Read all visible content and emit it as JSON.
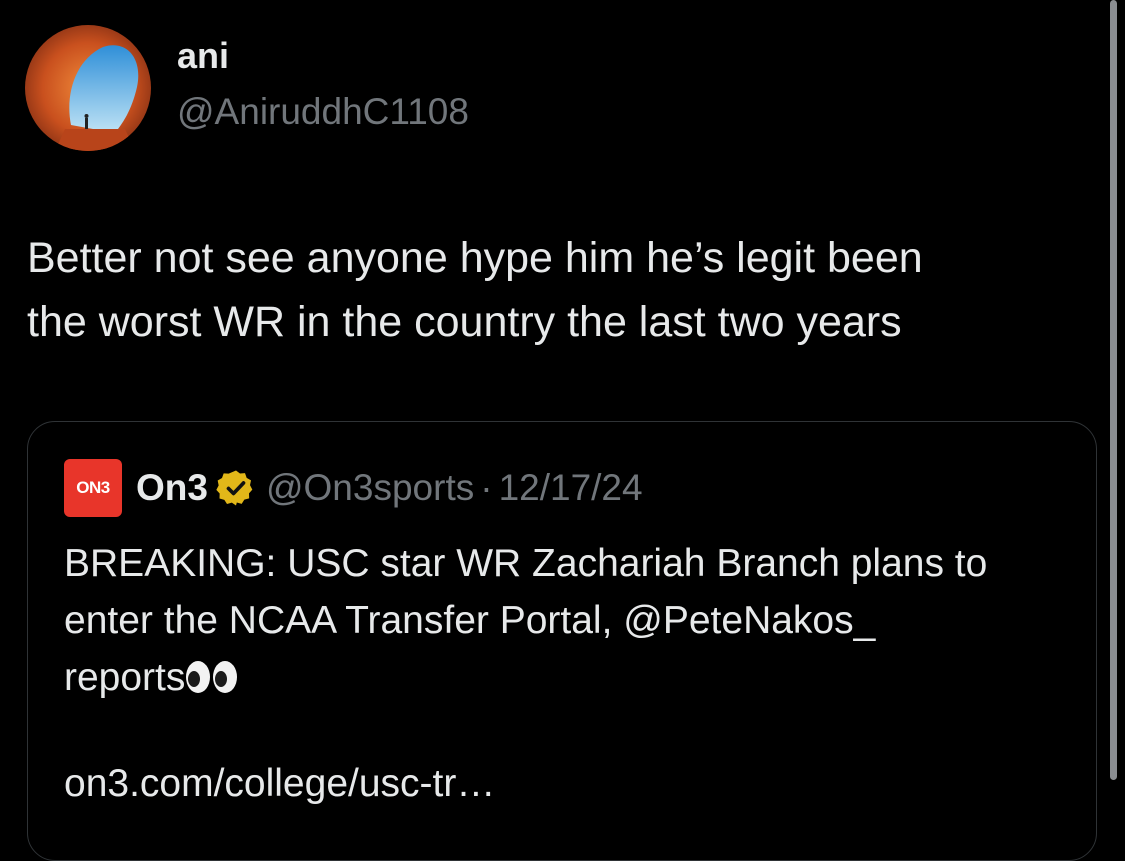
{
  "author": {
    "display_name": "ani",
    "handle": "@AniruddhC1108"
  },
  "tweet": {
    "text_lines": [
      "Better not see anyone hype him he’s legit been",
      "the worst WR in the country the last two years"
    ]
  },
  "quote": {
    "logo_text": "ON3",
    "name": "On3",
    "verified_icon": "gold-verified-badge-icon",
    "handle": "@On3sports",
    "separator": "·",
    "date": "12/17/24",
    "body_lines": [
      "BREAKING: USC star WR Zachariah Branch plans to",
      "enter the NCAA Transfer Portal, @PeteNakos_",
      "reports"
    ],
    "emoji": "eyes-emoji",
    "link": "on3.com/college/usc-tr…"
  },
  "colors": {
    "background": "#000000",
    "primary_text": "#e7e9ea",
    "secondary_text": "#71767b",
    "card_border": "#2f3336",
    "on3_brand": "#e8352a",
    "verified_gold": "#e2b719"
  }
}
